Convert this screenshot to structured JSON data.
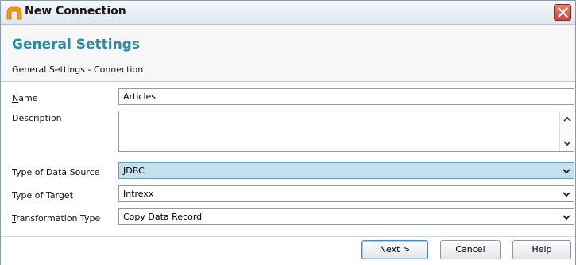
{
  "window": {
    "title": "New Connection"
  },
  "header": {
    "title": "General Settings",
    "subtitle": "General Settings - Connection"
  },
  "form": {
    "name": {
      "label_prefix": "",
      "label_access": "N",
      "label_rest": "ame",
      "value": "Articles"
    },
    "description": {
      "label": "Description",
      "value": ""
    },
    "data_source": {
      "label": "Type of Data Source",
      "value": "JDBC"
    },
    "target": {
      "label": "Type of Target",
      "value": "Intrexx"
    },
    "transformation": {
      "label_access": "T",
      "label_rest": "ransformation Type",
      "value": "Copy Data Record"
    }
  },
  "buttons": {
    "next": "Next >",
    "cancel": "Cancel",
    "help": "Help"
  },
  "colors": {
    "accent": "#2a8ca0",
    "selected_field": "#c4e0ef",
    "close_button": "#c94a33"
  }
}
